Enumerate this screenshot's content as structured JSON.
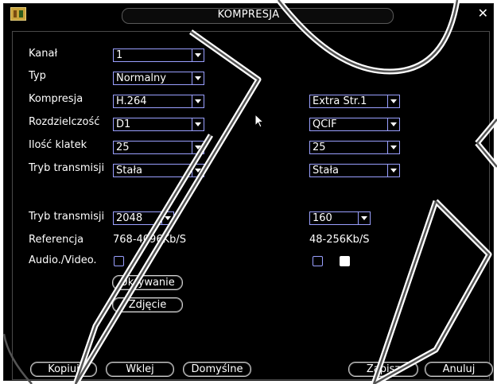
{
  "window": {
    "title": "KOMPRESJA",
    "close_glyph": "✕",
    "icon": "folder-app-icon"
  },
  "rows": [
    {
      "label": "Kanał",
      "main": "1"
    },
    {
      "label": "Typ",
      "main": "Normalny"
    },
    {
      "label": "Kompresja",
      "main": "H.264",
      "extra": "Extra Str.1"
    },
    {
      "label": "Rozdzielczość",
      "main": "D1",
      "extra": "QCIF"
    },
    {
      "label": "Ilość klatek",
      "main": "25",
      "extra": "25"
    },
    {
      "label": "Tryb transmisji",
      "main": "Stała",
      "extra": "Stała"
    }
  ],
  "bitrate": {
    "label": "Tryb transmisji",
    "main": "2048",
    "extra": "160"
  },
  "reference": {
    "label": "Referencja",
    "main": "768-4096Kb/S",
    "extra": "48-256Kb/S"
  },
  "audio_video": {
    "label": "Audio./Video.",
    "main_checked": false,
    "extra_checked": false,
    "extra2_checked": true
  },
  "middle_buttons": {
    "hide_label": "Ukrywanie",
    "snapshot_label": "Zdjęcie"
  },
  "footer": {
    "copy_label": "Kopiuj",
    "paste_label": "Wklej",
    "default_label": "Domyślne",
    "save_label": "Zapisz",
    "cancel_label": "Anuluj"
  },
  "colors": {
    "background": "#000000",
    "border_accent": "#9aa0ff",
    "text": "#ffffff"
  }
}
